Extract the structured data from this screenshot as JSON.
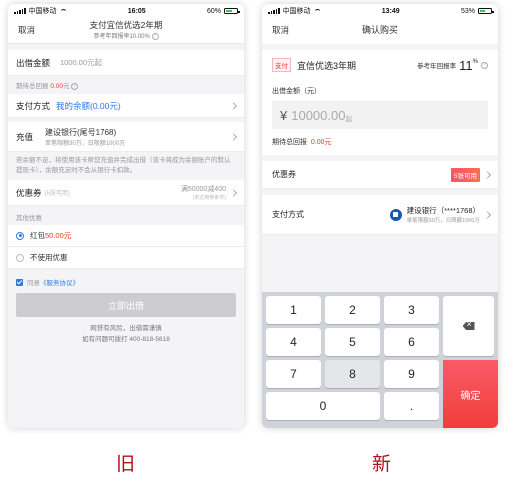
{
  "old": {
    "status": {
      "carrier": "中国移动",
      "time": "16:05",
      "battery": "60%"
    },
    "nav": {
      "cancel": "取消",
      "title": "支付宜信优选2年期",
      "subtitle": "参考年回报率10.00%"
    },
    "amount": {
      "label": "出借金额",
      "placeholder": "1000.00元起"
    },
    "expected": {
      "label": "期待总回报",
      "value": "0.00",
      "unit": "元"
    },
    "payment": {
      "label": "支付方式",
      "value": "我的余额(0.00元)"
    },
    "recharge": {
      "label": "充值",
      "bank": "建设银行(尾号1768)",
      "limit": "单笔限额30万，日限额1000万"
    },
    "notice": "若余额不足，将使用该卡帮您充值并完成出借（该卡将成为余额账户的默认提现卡），余额充足时不会从银行卡扣款。",
    "coupon": {
      "label": "优惠券",
      "count": "(5张可用)",
      "value": "满50000减400",
      "note": "(未达用券条件)"
    },
    "other_label": "其他优惠",
    "redpacket": {
      "prefix": "红包",
      "value": "50.00元"
    },
    "no_discount": "不使用优惠",
    "agree": {
      "prefix": "同意",
      "link": "《服务协议》"
    },
    "submit": "立即出借",
    "risk": "网贷有风险，出借需谨慎",
    "hotline": "如有问题可拨打 400-818-5618"
  },
  "new": {
    "status": {
      "carrier": "中国移动",
      "time": "13:49",
      "battery": "53%"
    },
    "nav": {
      "cancel": "取消",
      "title": "确认购买"
    },
    "product": {
      "tag": "支付",
      "name": "宜信优选3年期",
      "rate_label": "参考年回报率",
      "rate": "11",
      "rate_unit": "%"
    },
    "amount": {
      "label": "出借金额（元）",
      "currency": "¥",
      "placeholder": "10000.00",
      "suffix": "起"
    },
    "expected": {
      "label": "期待总回报",
      "value": "0.00元"
    },
    "coupon": {
      "label": "优惠券",
      "badge": "5张可用"
    },
    "payment": {
      "label": "支付方式",
      "bank": "建设银行（****1768）",
      "limit": "单笔限额30万，日限额1000万"
    },
    "keys": [
      "1",
      "2",
      "3",
      "4",
      "5",
      "6",
      "7",
      "8",
      "9",
      "0",
      "."
    ],
    "confirm": "确定"
  },
  "captions": {
    "old": "旧",
    "new": "新"
  }
}
